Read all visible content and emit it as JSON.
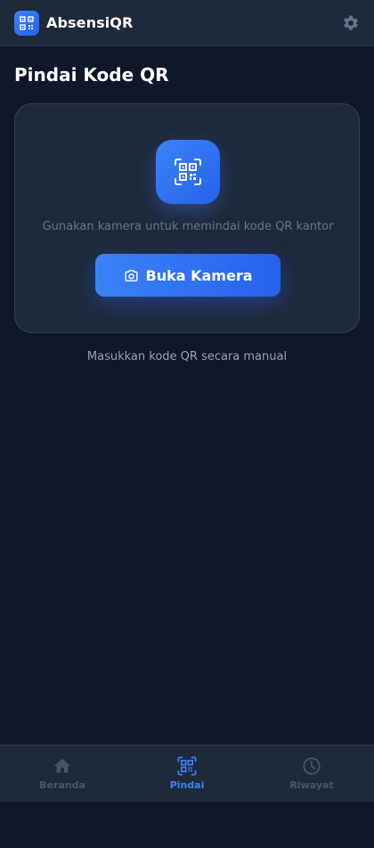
{
  "header": {
    "app_name": "AbsensiQR"
  },
  "page": {
    "title": "Pindai Kode QR"
  },
  "scan_card": {
    "hint": "Gunakan kamera untuk memindai kode QR kantor",
    "open_camera_label": "Buka Kamera"
  },
  "manual_entry": {
    "label": "Masukkan kode QR secara manual"
  },
  "bottom_nav": {
    "items": [
      {
        "label": "Beranda",
        "icon": "home-icon",
        "active": false
      },
      {
        "label": "Pindai",
        "icon": "qr-icon",
        "active": true
      },
      {
        "label": "Riwayat",
        "icon": "clock-icon",
        "active": false
      }
    ]
  },
  "colors": {
    "background": "#0f172a",
    "surface": "#1e293b",
    "accent": "#3b82f6",
    "muted": "#475569"
  }
}
